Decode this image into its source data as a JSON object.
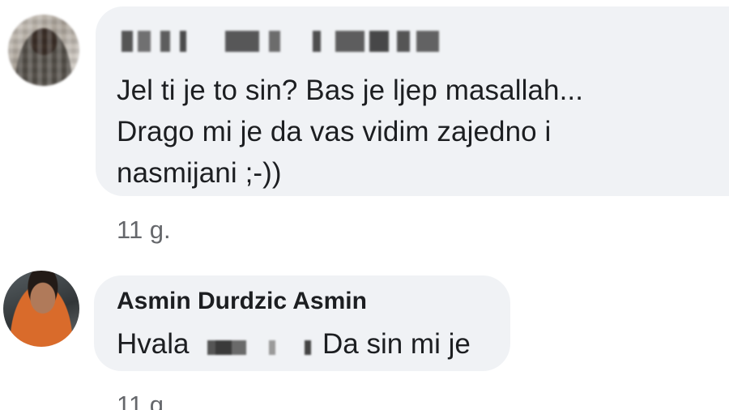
{
  "comments": [
    {
      "author": "",
      "author_redacted": true,
      "text_lines": [
        "Jel ti je to sin? Bas je ljep masallah...",
        "Drago mi je da vas vidim zajedno i",
        "nasmijani ;-))"
      ],
      "time": "11 g."
    },
    {
      "author": "Asmin Durdzic Asmin",
      "text_before_redaction": "Hvala",
      "text_after_redaction": "Da sin mi je",
      "time": "11 g."
    }
  ],
  "colors": {
    "bubble_bg": "#f0f2f5",
    "text": "#1c1e21",
    "meta": "#65676b"
  },
  "icons": {
    "first_avatar": "blurred-profile-photo",
    "second_avatar": "profile-photo"
  }
}
